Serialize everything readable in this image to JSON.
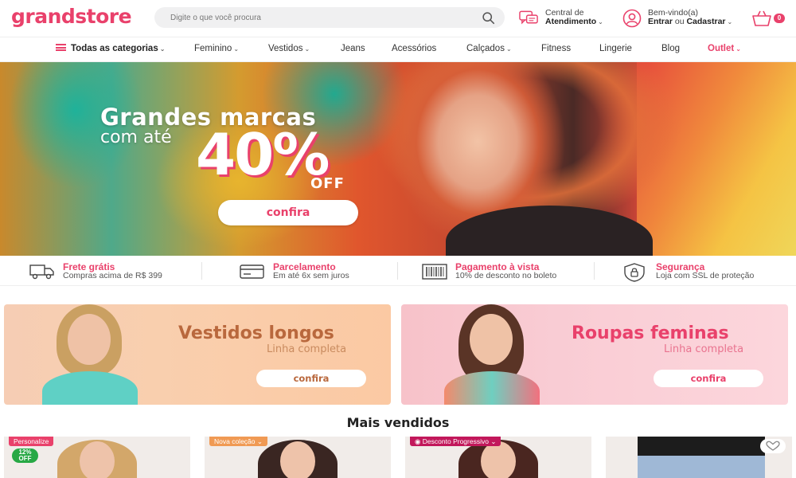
{
  "header": {
    "logo": "grandstore",
    "search_placeholder": "Digite o que você procura",
    "help_line1": "Central de",
    "help_line2": "Atendimento",
    "user_line1": "Bem-vindo(a)",
    "user_enter": "Entrar",
    "user_or": "ou",
    "user_register": "Cadastrar",
    "cart_count": "0"
  },
  "nav": {
    "all_categories": "Todas as categorias",
    "items": [
      "Feminino",
      "Vestidos",
      "Jeans",
      "Acessórios",
      "Calçados",
      "Fitness",
      "Lingerie",
      "Blog",
      "Outlet"
    ]
  },
  "hero": {
    "title": "Grandes marcas",
    "subtitle": "com até",
    "big": "40%",
    "off": "OFF",
    "button": "confira"
  },
  "benefits": [
    {
      "title": "Frete grátis",
      "desc": "Compras acima de R$ 399",
      "icon": "truck-icon"
    },
    {
      "title": "Parcelamento",
      "desc": "Em até 6x sem juros",
      "icon": "credit-card-icon"
    },
    {
      "title": "Pagamento à vista",
      "desc": "10% de desconto no boleto",
      "icon": "barcode-icon"
    },
    {
      "title": "Segurança",
      "desc": "Loja com SSL de proteção",
      "icon": "shield-lock-icon"
    }
  ],
  "banners": [
    {
      "title": "Vestidos longos",
      "subtitle": "Linha completa",
      "button": "confira",
      "color": "#b9683d"
    },
    {
      "title": "Roupas feminas",
      "subtitle": "Linha completa",
      "button": "confira",
      "color": "#e9416b"
    }
  ],
  "section_title": "Mais vendidos",
  "products": [
    {
      "badge": "Personalize",
      "discount": "12%",
      "discount_label": "OFF"
    },
    {
      "badge": "Nova coleção"
    },
    {
      "badge": "Desconto Progressivo"
    },
    {
      "badge": ""
    }
  ],
  "colors": {
    "brand": "#e9416b",
    "discount": "#27a845",
    "new": "#f09a54",
    "progressive": "#c2185b"
  }
}
